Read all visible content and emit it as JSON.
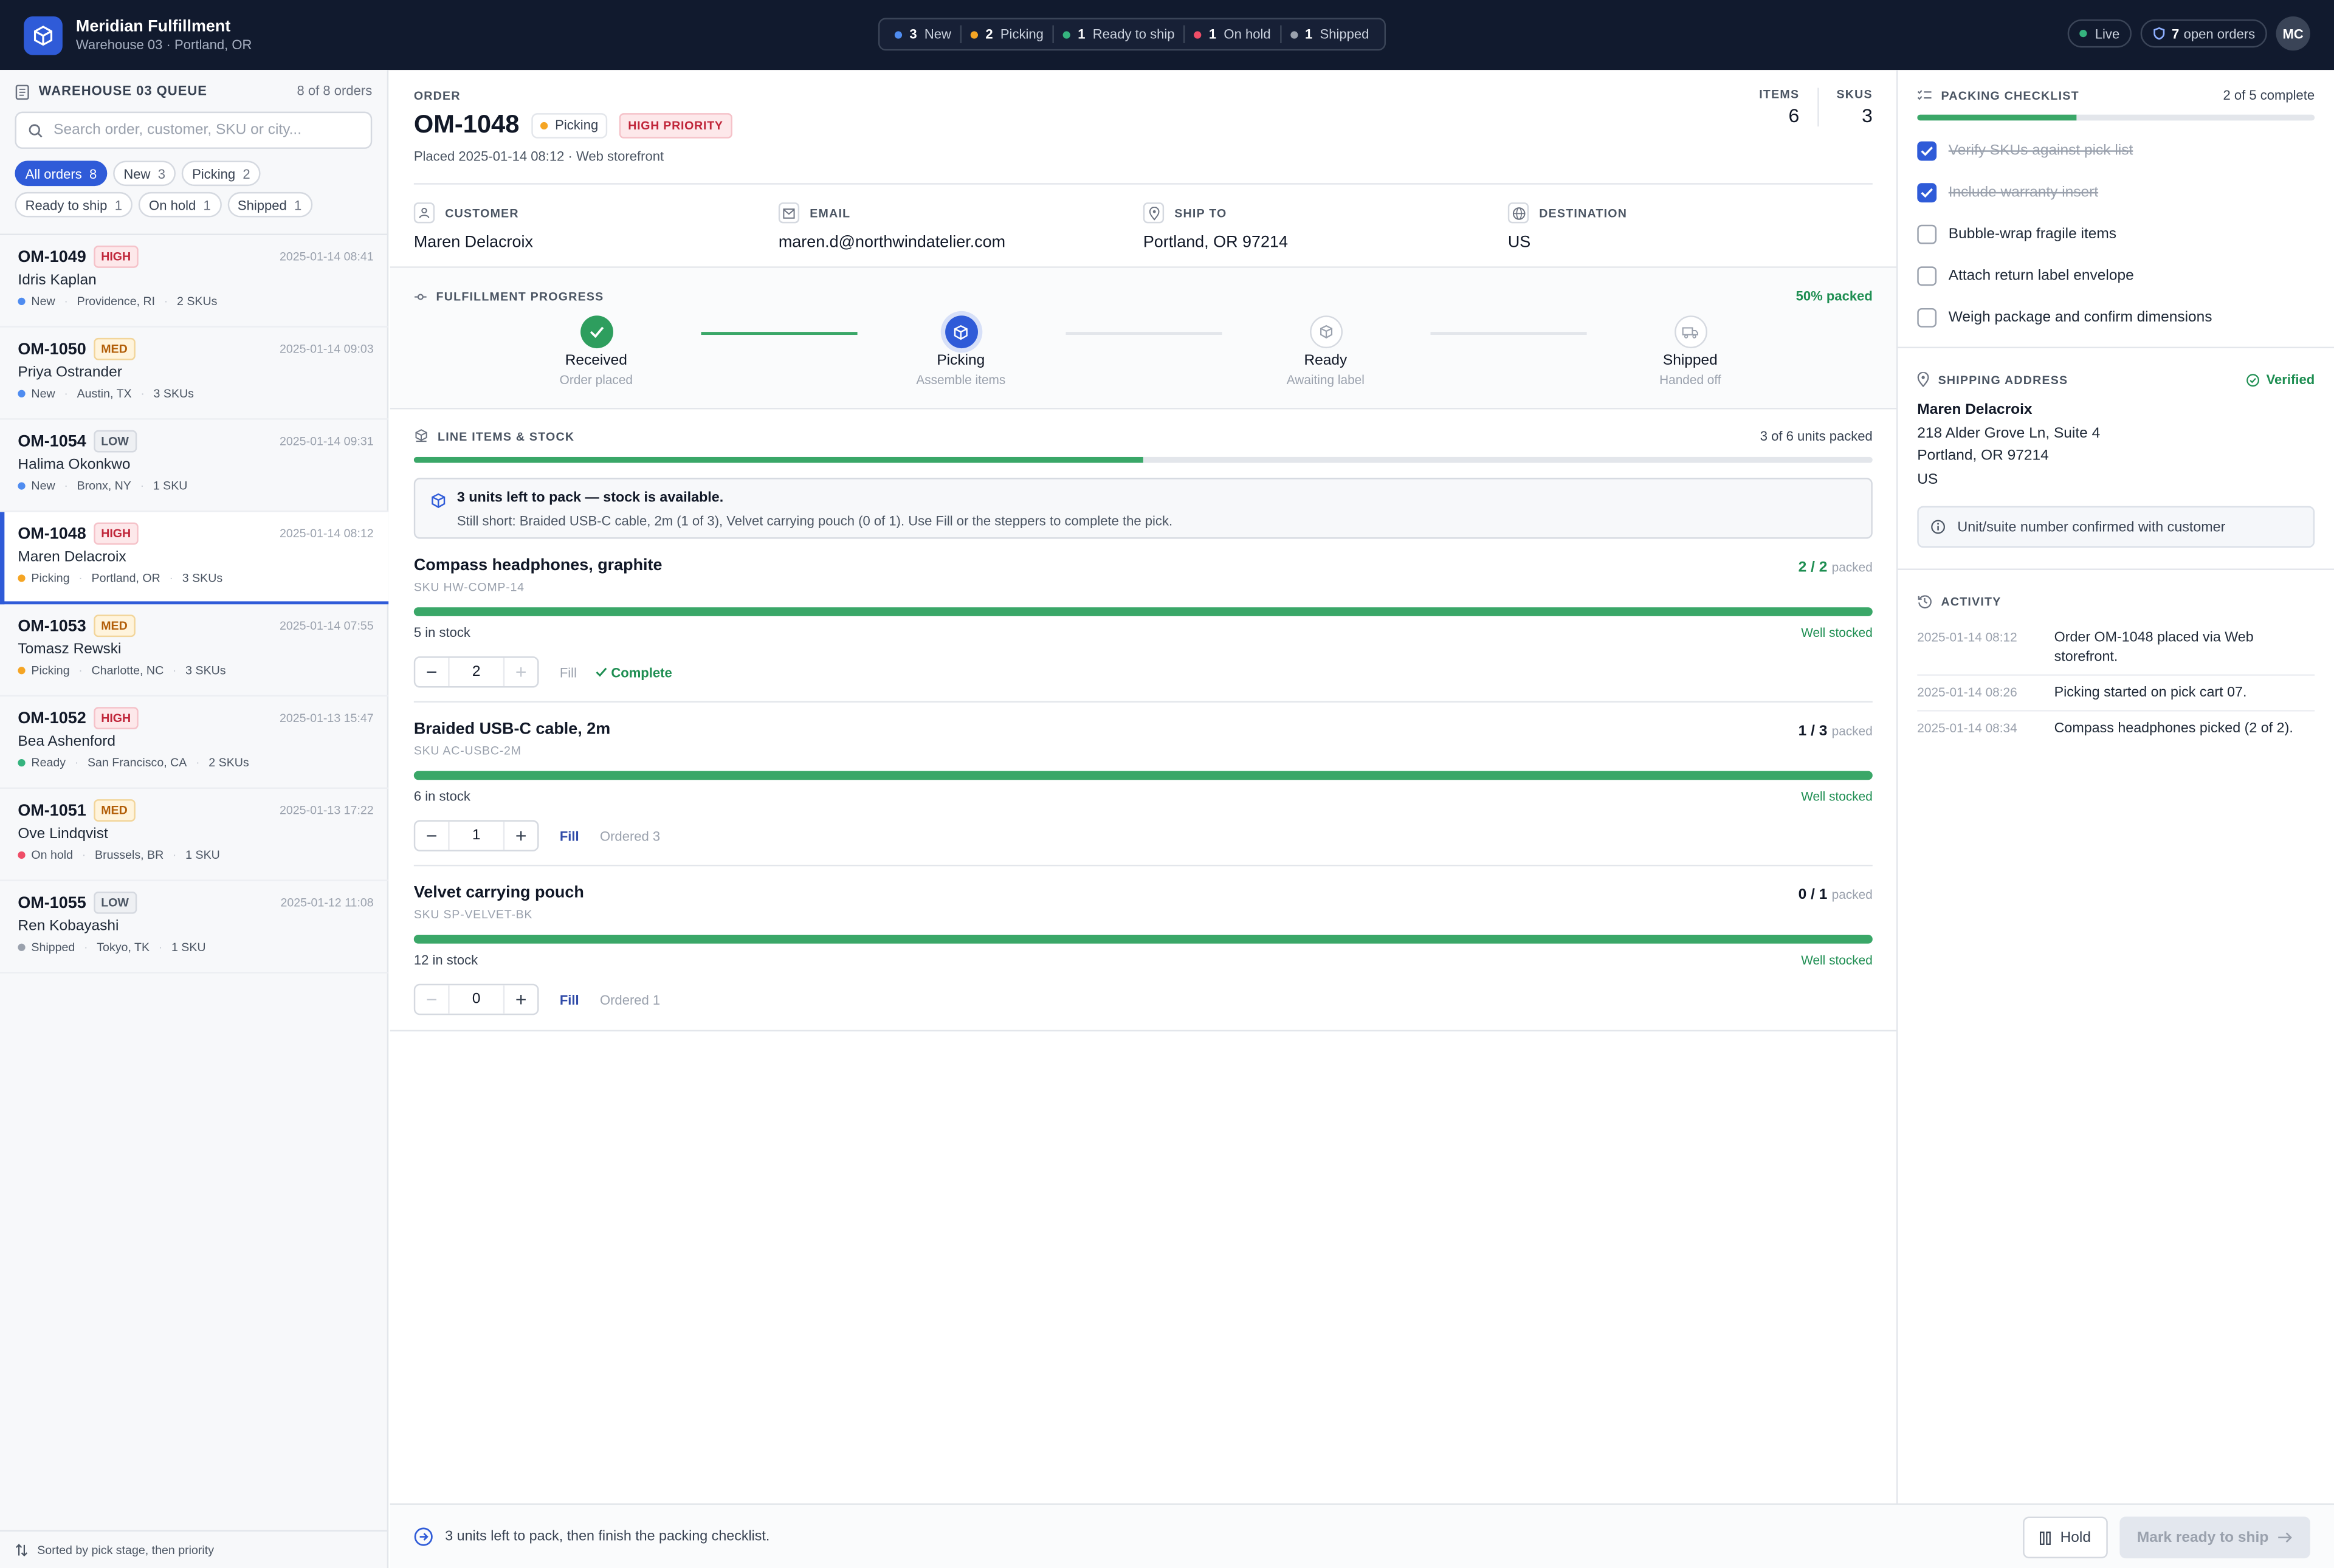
{
  "app": {
    "name": "Meridian Fulfillment",
    "subtitle": "Warehouse 03 · Portland, OR"
  },
  "status_summary": [
    {
      "count": "3",
      "label": "New",
      "color": "#4f8cf0"
    },
    {
      "count": "2",
      "label": "Picking",
      "color": "#f5a524"
    },
    {
      "count": "1",
      "label": "Ready to ship",
      "color": "#35b37e"
    },
    {
      "count": "1",
      "label": "On hold",
      "color": "#ef4d67"
    },
    {
      "count": "1",
      "label": "Shipped",
      "color": "#9aa1ad"
    }
  ],
  "header_right": {
    "live": "Live",
    "open_count": "7",
    "open_label": "open orders",
    "avatar": "MC"
  },
  "sidebar": {
    "title": "WAREHOUSE 03 QUEUE",
    "count": "8 of 8 orders",
    "search_placeholder": "Search order, customer, SKU or city...",
    "filters": [
      {
        "label": "All orders",
        "count": "8",
        "active": true
      },
      {
        "label": "New",
        "count": "3"
      },
      {
        "label": "Picking",
        "count": "2"
      },
      {
        "label": "Ready to ship",
        "count": "1"
      },
      {
        "label": "On hold",
        "count": "1"
      },
      {
        "label": "Shipped",
        "count": "1"
      }
    ],
    "orders": [
      {
        "id": "OM-1049",
        "priority": "HIGH",
        "time": "2025-01-14 08:41",
        "customer": "Idris Kaplan",
        "status": "New",
        "status_color": "#4f8cf0",
        "city": "Providence, RI",
        "skus": "2 SKUs"
      },
      {
        "id": "OM-1050",
        "priority": "MED",
        "time": "2025-01-14 09:03",
        "customer": "Priya Ostrander",
        "status": "New",
        "status_color": "#4f8cf0",
        "city": "Austin, TX",
        "skus": "3 SKUs"
      },
      {
        "id": "OM-1054",
        "priority": "LOW",
        "time": "2025-01-14 09:31",
        "customer": "Halima Okonkwo",
        "status": "New",
        "status_color": "#4f8cf0",
        "city": "Bronx, NY",
        "skus": "1 SKU"
      },
      {
        "id": "OM-1048",
        "priority": "HIGH",
        "time": "2025-01-14 08:12",
        "customer": "Maren Delacroix",
        "status": "Picking",
        "status_color": "#f5a524",
        "city": "Portland, OR",
        "skus": "3 SKUs",
        "selected": true
      },
      {
        "id": "OM-1053",
        "priority": "MED",
        "time": "2025-01-14 07:55",
        "customer": "Tomasz Rewski",
        "status": "Picking",
        "status_color": "#f5a524",
        "city": "Charlotte, NC",
        "skus": "3 SKUs"
      },
      {
        "id": "OM-1052",
        "priority": "HIGH",
        "time": "2025-01-13 15:47",
        "customer": "Bea Ashenford",
        "status": "Ready",
        "status_color": "#35b37e",
        "city": "San Francisco, CA",
        "skus": "2 SKUs"
      },
      {
        "id": "OM-1051",
        "priority": "MED",
        "time": "2025-01-13 17:22",
        "customer": "Ove Lindqvist",
        "status": "On hold",
        "status_color": "#ef4d67",
        "city": "Brussels, BR",
        "skus": "1 SKU"
      },
      {
        "id": "OM-1055",
        "priority": "LOW",
        "time": "2025-01-12 11:08",
        "customer": "Ren Kobayashi",
        "status": "Shipped",
        "status_color": "#9aa1ad",
        "city": "Tokyo, TK",
        "skus": "1 SKU"
      }
    ],
    "footer": "Sorted by pick stage, then priority"
  },
  "order": {
    "label": "ORDER",
    "id": "OM-1048",
    "status": "Picking",
    "priority": "HIGH PRIORITY",
    "placed": "Placed 2025-01-14 08:12 · Web storefront",
    "items_label": "ITEMS",
    "items": "6",
    "skus_label": "SKUS",
    "skus": "3",
    "customer_label": "CUSTOMER",
    "customer": "Maren Delacroix",
    "email_label": "EMAIL",
    "email": "maren.d@northwindatelier.com",
    "shipto_label": "SHIP TO",
    "shipto": "Portland, OR 97214",
    "dest_label": "DESTINATION",
    "dest": "US"
  },
  "progress": {
    "title": "FULFILLMENT PROGRESS",
    "pct": "50% packed",
    "steps": [
      {
        "name": "Received",
        "sub": "Order placed",
        "state": "done"
      },
      {
        "name": "Picking",
        "sub": "Assemble items",
        "state": "current"
      },
      {
        "name": "Ready",
        "sub": "Awaiting label",
        "state": "todo"
      },
      {
        "name": "Shipped",
        "sub": "Handed off",
        "state": "todo"
      }
    ]
  },
  "line_items": {
    "title": "LINE ITEMS & STOCK",
    "summary": "3 of 6 units packed",
    "packed_fraction": 0.5,
    "notice_title": "3 units left to pack — stock is available.",
    "notice_sub": "Still short: Braided USB-C cable, 2m (1 of 3), Velvet carrying pouch (0 of 1). Use Fill or the steppers to complete the pick.",
    "items": [
      {
        "name": "Compass headphones, graphite",
        "sku": "SKU HW-COMP-14",
        "packed": "2 / 2",
        "packed_word": "packed",
        "stock": "5 in stock",
        "stock_state": "Well stocked",
        "qty": "2",
        "fill": "Fill",
        "extra": "Complete",
        "complete": true
      },
      {
        "name": "Braided USB-C cable, 2m",
        "sku": "SKU AC-USBC-2M",
        "packed": "1 / 3",
        "packed_word": "packed",
        "stock": "6 in stock",
        "stock_state": "Well stocked",
        "qty": "1",
        "fill": "Fill",
        "extra": "Ordered 3",
        "complete": false
      },
      {
        "name": "Velvet carrying pouch",
        "sku": "SKU SP-VELVET-BK",
        "packed": "0 / 1",
        "packed_word": "packed",
        "stock": "12 in stock",
        "stock_state": "Well stocked",
        "qty": "0",
        "fill": "Fill",
        "extra": "Ordered 1",
        "complete": false
      }
    ]
  },
  "checklist": {
    "title": "PACKING CHECKLIST",
    "summary": "2 of 5 complete",
    "done_fraction": 0.4,
    "items": [
      {
        "label": "Verify SKUs against pick list",
        "done": true
      },
      {
        "label": "Include warranty insert",
        "done": true
      },
      {
        "label": "Bubble-wrap fragile items",
        "done": false
      },
      {
        "label": "Attach return label envelope",
        "done": false
      },
      {
        "label": "Weigh package and confirm dimensions",
        "done": false
      }
    ]
  },
  "shipping": {
    "title": "SHIPPING ADDRESS",
    "verified": "Verified",
    "name": "Maren Delacroix",
    "line1": "218 Alder Grove Ln, Suite 4",
    "line2": "Portland, OR 97214",
    "country": "US",
    "note": "Unit/suite number confirmed with customer"
  },
  "activity": {
    "title": "ACTIVITY",
    "entries": [
      {
        "time": "2025-01-14 08:12",
        "text": "Order OM-1048 placed via Web storefront."
      },
      {
        "time": "2025-01-14 08:26",
        "text": "Picking started on pick cart 07."
      },
      {
        "time": "2025-01-14 08:34",
        "text": "Compass headphones picked (2 of 2)."
      }
    ]
  },
  "footer": {
    "message": "3 units left to pack, then finish the packing checklist.",
    "hold": "Hold",
    "ready": "Mark ready to ship"
  },
  "colors": {
    "accent": "#2f5bd8",
    "success": "#3aa768",
    "topbar": "#111a2e"
  }
}
